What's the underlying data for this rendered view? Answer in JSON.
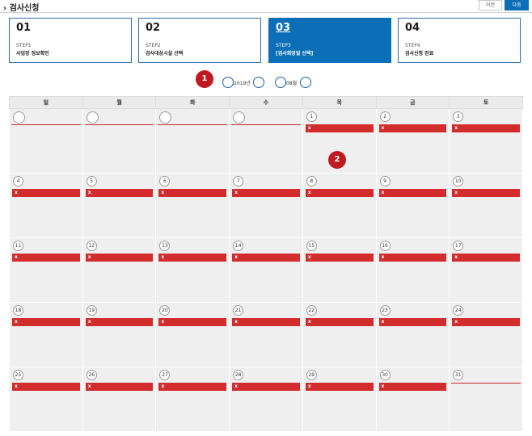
{
  "header": {
    "title": "› 검사신청",
    "prev_label": "이전",
    "next_label": "다음"
  },
  "steps": [
    {
      "num": "01",
      "step": "STEP1",
      "desc": "사업장 정보확인"
    },
    {
      "num": "02",
      "step": "STEP2",
      "desc": "검사대상시설 선택"
    },
    {
      "num": "03",
      "step": "STEP3",
      "desc": "[검사희망일 선택]"
    },
    {
      "num": "04",
      "step": "STEP4",
      "desc": "검사신청 완료"
    }
  ],
  "markers": [
    "1",
    "2"
  ],
  "selector": {
    "year": "2019년",
    "month": "08월"
  },
  "calendar": {
    "weekdays": [
      "일",
      "월",
      "화",
      "수",
      "목",
      "금",
      "토"
    ],
    "bar_label": "x",
    "weeks": [
      [
        "",
        "",
        "",
        "",
        "1",
        "2",
        "3"
      ],
      [
        "4",
        "5",
        "6",
        "7",
        "8",
        "9",
        "10"
      ],
      [
        "11",
        "12",
        "13",
        "14",
        "15",
        "16",
        "17"
      ],
      [
        "18",
        "19",
        "20",
        "21",
        "22",
        "23",
        "24"
      ],
      [
        "25",
        "26",
        "27",
        "28",
        "29",
        "30",
        "31"
      ]
    ]
  },
  "colors": {
    "accent": "#0a6fb7",
    "unavailable": "#d22c2c",
    "marker": "#c0191f",
    "cell": "#efefef"
  }
}
